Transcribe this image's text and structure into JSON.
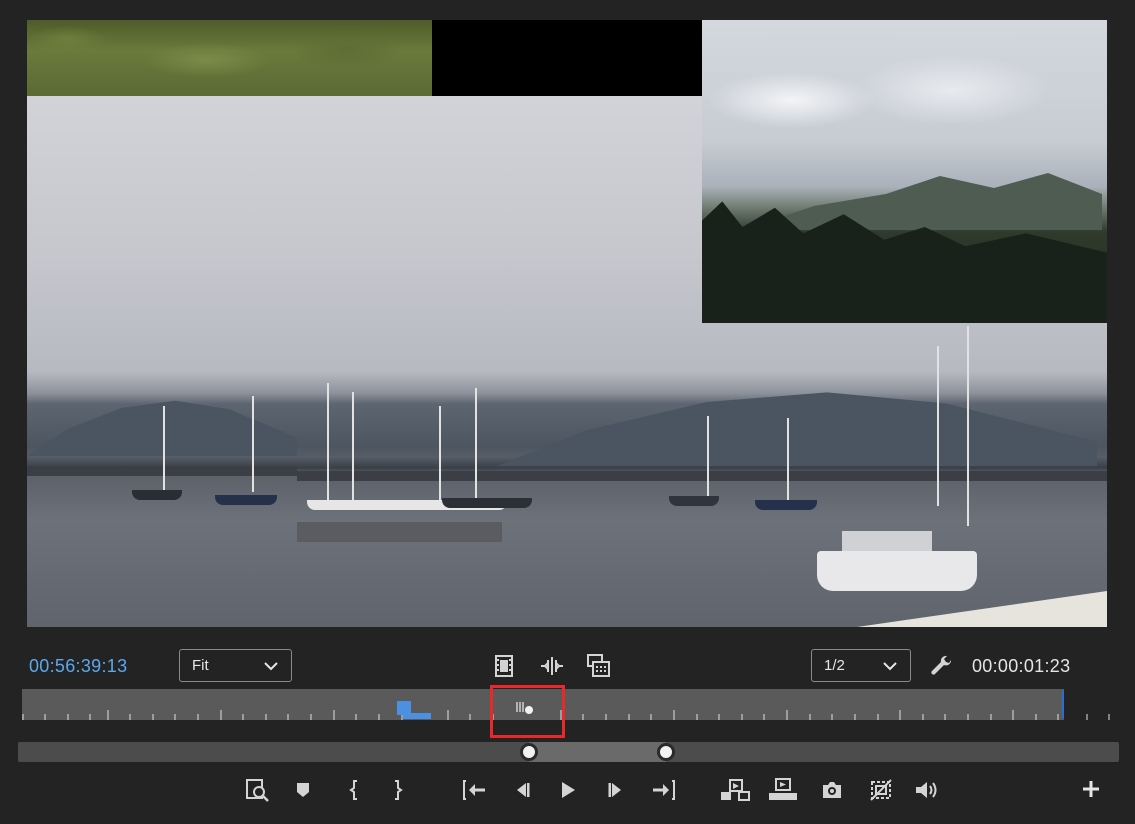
{
  "monitor": {
    "current_timecode": "00:56:39:13",
    "duration_timecode": "00:00:01:23",
    "zoom_dropdown": {
      "selected": "Fit"
    },
    "resolution_dropdown": {
      "selected": "1/2"
    }
  },
  "center_buttons": [
    {
      "name": "drag-video-only",
      "icon": "film-strip-icon"
    },
    {
      "name": "drag-audio-only",
      "icon": "audio-waveform-icon"
    },
    {
      "name": "multicam-toggle",
      "icon": "multicam-icon"
    }
  ],
  "transport_buttons": [
    {
      "name": "export-frame-preview",
      "icon": "magnify-frame-icon"
    },
    {
      "name": "add-marker",
      "icon": "marker-icon"
    },
    {
      "name": "mark-in",
      "icon": "mark-in-icon"
    },
    {
      "name": "mark-out",
      "icon": "mark-out-icon"
    },
    {
      "name": "go-to-in",
      "icon": "go-to-in-icon"
    },
    {
      "name": "step-back",
      "icon": "step-back-icon"
    },
    {
      "name": "play",
      "icon": "play-icon"
    },
    {
      "name": "step-forward",
      "icon": "step-forward-icon"
    },
    {
      "name": "go-to-out",
      "icon": "go-to-out-icon"
    },
    {
      "name": "insert",
      "icon": "insert-icon"
    },
    {
      "name": "overwrite",
      "icon": "overwrite-icon"
    },
    {
      "name": "export-frame",
      "icon": "camera-icon"
    },
    {
      "name": "safe-margins",
      "icon": "safe-margins-icon"
    },
    {
      "name": "mute-audio",
      "icon": "speaker-icon"
    },
    {
      "name": "button-editor",
      "icon": "plus-icon"
    }
  ],
  "colors": {
    "accent": "#5aa8ee",
    "highlight": "#e8282a",
    "background": "#232323"
  }
}
